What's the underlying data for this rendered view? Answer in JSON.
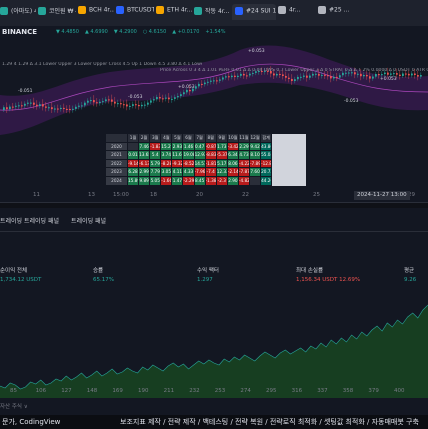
{
  "browser_tabs": [
    {
      "label": "(아마도) 4r...",
      "color": "#26a69a",
      "active": false
    },
    {
      "label": "코인원 ₩ 4r...",
      "color": "#26a69a",
      "active": false
    },
    {
      "label": "BCH 4r...",
      "color": "#f7a600",
      "active": false
    },
    {
      "label": "BTCUSDT 4r...",
      "color": "#2962ff",
      "active": false
    },
    {
      "label": "ETH 4r...",
      "color": "#f7a600",
      "active": false
    },
    {
      "label": "작동 4r...",
      "color": "#26a69a",
      "active": false
    },
    {
      "label": "#24 SUI 1 4r...",
      "color": "#2962ff",
      "active": true
    },
    {
      "label": "4r...",
      "color": "#b2b5be",
      "active": false
    },
    {
      "label": "#25 ...",
      "color": "#b2b5be",
      "active": false
    }
  ],
  "symbol_bar": {
    "exchange": "BINANCE",
    "values": [
      "▼ 4.4850",
      "▲ 4.6990",
      "▼ 4.2900",
      "○ 4.6150",
      "▲ +0.0170",
      "+1.54%"
    ]
  },
  "indicators": {
    "line1": "1.29 4 1.29 ∆ 3.1 Lower Upper 3 Lower Upper Cross 4.5 Up 1 Down 4.5 3.80 ∆ 4.1 Lower Upper ∆ Lower Upper Cross 1 MA 3.8",
    "line2": "Price Across 0 3 4 ∆ 1.01 PERF 0.01 ∆ ∆ 0.04 DWS 0.7 Lower Upper 3 ∆ 0 STRAT 0 ∆ ∆ T 2% 0.0000 ∆ 0 USDT 0 ATR 0 3 ∆ ∆ strict Scalping 0 ∆"
  },
  "chart_annotations": [
    "-0.051",
    "-0.053",
    "+0.053",
    "+0.053",
    "-0.053",
    "+0.053"
  ],
  "perf_table": {
    "header": [
      "",
      "1월",
      "2월",
      "3월",
      "4월",
      "5월",
      "6월",
      "7월",
      "8월",
      "9월",
      "10월",
      "11월",
      "12월",
      "합계"
    ],
    "rows": [
      {
        "year": "2020",
        "values": [
          "",
          "7.46",
          "-1.83",
          "15.29",
          "2.93",
          "1.46",
          "0.47",
          "-0.87",
          "1.73",
          "-3.42",
          "2.29",
          "9.42",
          "43.86"
        ]
      },
      {
        "year": "2021",
        "values": [
          "0.01",
          "13.65",
          "5.4",
          "3.74",
          "11.67",
          "19.08",
          "12.93",
          "-8.83",
          "-5.37",
          "6.34",
          "4.73",
          "8.10",
          "55.04"
        ]
      },
      {
        "year": "2022",
        "values": [
          "-9.14",
          "-6.13",
          "5.79",
          "-8.28",
          "-9.32",
          "-8.52",
          "14.57",
          "-1.81",
          "5.17",
          "8.06",
          "-4.22",
          "-7.89",
          "-12.81"
        ]
      },
      {
        "year": "2023",
        "values": [
          "6.28",
          "2.99",
          "7.79",
          "3.05",
          "4.11",
          "4.33",
          "-7.96",
          "-7.4",
          "12.33",
          "-2.14",
          "-7.87",
          "7.60",
          "20.73"
        ]
      },
      {
        "year": "2024",
        "values": [
          "15.89",
          "9.89",
          "5.05",
          "-1.66",
          "1.47",
          "-2.29",
          "8.45",
          "-1.38",
          "-2.3",
          "2.90",
          "-4.82",
          "",
          "44.26"
        ]
      }
    ]
  },
  "x_axis": [
    "11",
    "13",
    "15:00",
    "18",
    "20",
    "22",
    "25",
    "29"
  ],
  "crosshair_label": "2024-11-27  13:00",
  "panel_tabs": [
    "트레이딩 트레이딩 패널",
    "트레이딩 패널"
  ],
  "metrics": [
    {
      "label": "순이익 전체",
      "value": "1,734.12 USDT",
      "color": "#26a69a"
    },
    {
      "label": "승률",
      "value": "65.17%",
      "color": "#26a69a"
    },
    {
      "label": "수익 팩터",
      "value": "1.297",
      "color": "#26a69a"
    },
    {
      "label": "최대 손실률",
      "value": "1,156.34 USDT",
      "sub": "12.69%",
      "color": "#ef5350"
    },
    {
      "label": "평균",
      "value": "9.26",
      "color": "#26a69a"
    }
  ],
  "equity_axis": [
    "85",
    "106",
    "127",
    "148",
    "169",
    "190",
    "211",
    "232",
    "253",
    "274",
    "295",
    "316",
    "337",
    "358",
    "379",
    "400"
  ],
  "equity_footer": "자산 주식 ∨",
  "equity_series": [
    0.12,
    0.1,
    0.15,
    0.13,
    0.09,
    0.11,
    0.16,
    0.14,
    0.18,
    0.13,
    0.15,
    0.19,
    0.17,
    0.22,
    0.18,
    0.21,
    0.25,
    0.2,
    0.23,
    0.27,
    0.22,
    0.25,
    0.29,
    0.24,
    0.26,
    0.3,
    0.27,
    0.25,
    0.31,
    0.28,
    0.33,
    0.3,
    0.27,
    0.32,
    0.35,
    0.31,
    0.34,
    0.29,
    0.33,
    0.37,
    0.34,
    0.38,
    0.35,
    0.33,
    0.39,
    0.36,
    0.41,
    0.38,
    0.43,
    0.4,
    0.37,
    0.42,
    0.46,
    0.43,
    0.4,
    0.45,
    0.48,
    0.44,
    0.47,
    0.5,
    0.46,
    0.52,
    0.49,
    0.55,
    0.51,
    0.58,
    0.54,
    0.6,
    0.56,
    0.63,
    0.59,
    0.66,
    0.62,
    0.68,
    0.72,
    0.67,
    0.75,
    0.71,
    0.78,
    0.74,
    0.81,
    0.85,
    0.8,
    0.88,
    0.93
  ],
  "banner": {
    "left": "문가, CodingView",
    "right": "보조지표 제작 / 전략 제작 / 백테스팅 / 전략 복원 / 전략로직 최적화 / 셋팅값 최적화 / 자동매매봇 구축"
  },
  "colors": {
    "up": "#26a69a",
    "down": "#ef5350",
    "accent": "#2962ff",
    "band": "#7b1fa2"
  }
}
